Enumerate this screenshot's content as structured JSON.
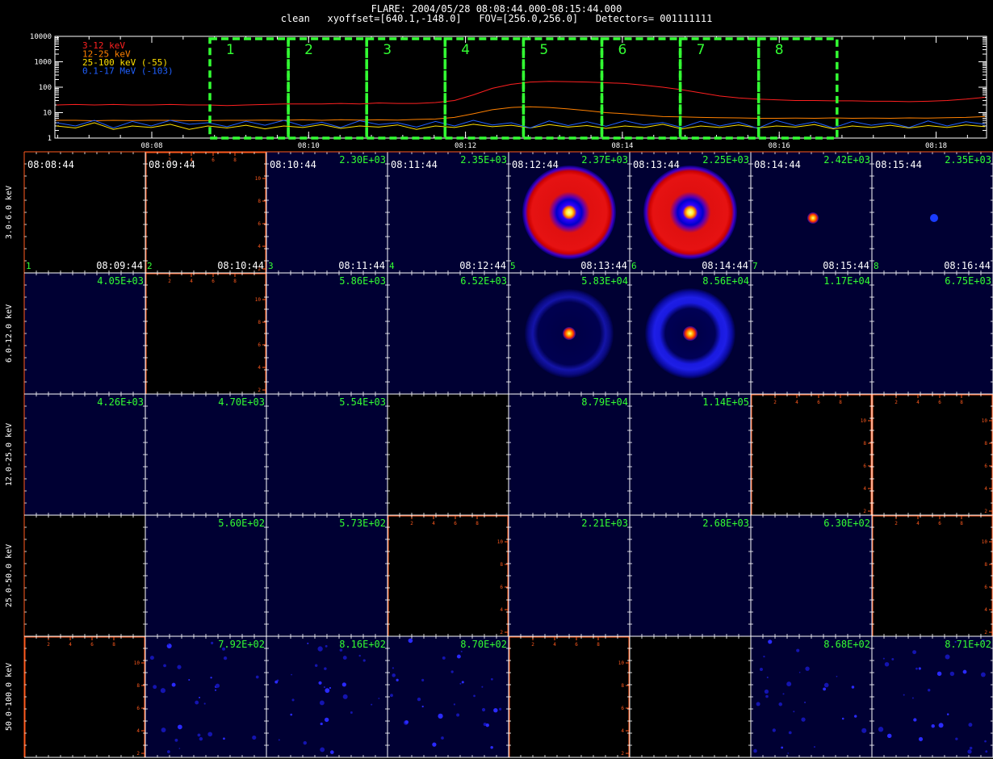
{
  "header": {
    "title": "FLARE: 2004/05/28 08:08:44.000-08:15:44.000",
    "subtitle": "clean   xyoffset=[640.1,-148.0]   FOV=[256.0,256.0]   Detectors= 001111111"
  },
  "chart_data": [
    {
      "type": "line",
      "name": "lightcurve",
      "y_scale": "log",
      "ylim": [
        1,
        10000
      ],
      "y_ticks": [
        "10000",
        "1000",
        "100",
        "10",
        "1"
      ],
      "x_ticks": [
        "08:08",
        "08:10",
        "08:12",
        "08:14",
        "08:16",
        "08:18"
      ],
      "series": [
        {
          "name": "3-12 keV",
          "color": "#ff2020",
          "values": [
            20,
            21,
            20,
            21,
            20,
            20,
            21,
            20,
            20,
            19,
            20,
            21,
            22,
            22,
            22,
            23,
            22,
            24,
            23,
            23,
            25,
            30,
            50,
            90,
            130,
            160,
            170,
            165,
            160,
            150,
            140,
            120,
            100,
            80,
            60,
            45,
            38,
            34,
            32,
            30,
            30,
            29,
            29,
            28,
            28,
            27,
            28,
            30,
            34,
            40
          ]
        },
        {
          "name": "12-25 keV",
          "color": "#ff8000",
          "values": [
            5,
            5,
            4.8,
            5,
            4.9,
            5,
            5,
            4.8,
            4.9,
            5,
            5,
            5.1,
            5,
            5.2,
            5,
            5.3,
            5.1,
            5.2,
            5.1,
            5.4,
            5.6,
            6.5,
            9,
            13,
            16,
            17,
            16,
            14,
            12,
            10,
            9,
            8,
            7,
            6.8,
            6.5,
            6.3,
            6.2,
            6,
            6,
            6.1,
            6,
            6.2,
            6,
            6.1,
            6,
            6.2,
            6.1,
            6.3,
            6.5,
            7
          ]
        },
        {
          "name": "25-100 keV (-55)",
          "color": "#ffe000",
          "values": [
            3,
            2.5,
            4,
            2.2,
            3,
            2.6,
            3.5,
            2.2,
            3,
            2.5,
            3.2,
            2.3,
            3,
            2.6,
            3.4,
            2.4,
            3,
            2.7,
            3.3,
            2.2,
            3,
            2.6,
            3.5,
            2.8,
            3.2,
            2.5,
            3.4,
            2.7,
            3.1,
            2.4,
            3,
            2.6,
            3.5,
            2.3,
            3,
            2.6,
            3.3,
            2.5,
            3,
            2.7,
            3.4,
            2.3,
            3,
            2.6,
            3.2,
            2.5,
            3.1,
            2.6,
            3.3,
            2.8
          ]
        },
        {
          "name": "0.1-17 MeV (-103)",
          "color": "#2060ff",
          "values": [
            4,
            3,
            5,
            2.5,
            4.5,
            3,
            5,
            3.5,
            4,
            2.8,
            4.6,
            3.2,
            5,
            3,
            4.2,
            2.6,
            4.8,
            3.4,
            4,
            2.7,
            4.5,
            3,
            5,
            3.3,
            4,
            2.5,
            4.7,
            3.1,
            4.4,
            2.9,
            4.8,
            3.3,
            4.1,
            2.6,
            4.6,
            3,
            4.2,
            2.4,
            4.9,
            3.1,
            4.3,
            2.5,
            4.5,
            3.2,
            4,
            2.6,
            4.7,
            3,
            4.4,
            3.5
          ]
        }
      ],
      "time_intervals": [
        "1",
        "2",
        "3",
        "4",
        "5",
        "6",
        "7",
        "8"
      ]
    },
    {
      "type": "heatmap",
      "name": "image-grid",
      "rows": [
        "3.0-6.0 keV",
        "6.0-12.0 keV",
        "12.0-25.0 keV",
        "25.0-50.0 keV",
        "50.0-100.0 keV"
      ],
      "columns": [
        "08:08:44",
        "08:09:44",
        "08:10:44",
        "08:11:44",
        "08:12:44",
        "08:13:44",
        "08:14:44",
        "08:15:44"
      ],
      "end_times": [
        "08:09:44",
        "08:10:44",
        "08:11:44",
        "08:12:44",
        "08:13:44",
        "08:14:44",
        "08:15:44",
        "08:16:44"
      ],
      "interval_numbers": [
        "1",
        "2",
        "3",
        "4",
        "5",
        "6",
        "7",
        "8"
      ],
      "axis_ticks_y": [
        "2",
        "4",
        "6",
        "8",
        "10"
      ],
      "axis_ticks_x": [
        "2",
        "4",
        "6",
        "8"
      ],
      "cells": [
        [
          {
            "label": "",
            "image": "blank"
          },
          {
            "label": "",
            "image": "axes"
          },
          {
            "label": "2.30E+03",
            "image": "none"
          },
          {
            "label": "2.35E+03",
            "image": "none"
          },
          {
            "label": "2.37E+03",
            "image": "ring-big"
          },
          {
            "label": "2.25E+03",
            "image": "ring-big"
          },
          {
            "label": "2.42E+03",
            "image": "spot-small"
          },
          {
            "label": "2.35E+03",
            "image": "spot-tiny"
          }
        ],
        [
          {
            "label": "4.05E+03",
            "image": "none"
          },
          {
            "label": "",
            "image": "axes"
          },
          {
            "label": "5.86E+03",
            "image": "none"
          },
          {
            "label": "6.52E+03",
            "image": "none"
          },
          {
            "label": "5.83E+04",
            "image": "ring-faint"
          },
          {
            "label": "8.56E+04",
            "image": "ring-blue"
          },
          {
            "label": "1.17E+04",
            "image": "none"
          },
          {
            "label": "6.75E+03",
            "image": "none"
          }
        ],
        [
          {
            "label": "4.26E+03",
            "image": "none"
          },
          {
            "label": "4.70E+03",
            "image": "none"
          },
          {
            "label": "5.54E+03",
            "image": "none"
          },
          {
            "label": "",
            "image": "blank"
          },
          {
            "label": "8.79E+04",
            "image": "none"
          },
          {
            "label": "1.14E+05",
            "image": "none"
          },
          {
            "label": "",
            "image": "axes"
          },
          {
            "label": "",
            "image": "axes"
          }
        ],
        [
          {
            "label": "",
            "image": "blank"
          },
          {
            "label": "5.60E+02",
            "image": "none"
          },
          {
            "label": "5.73E+02",
            "image": "none"
          },
          {
            "label": "",
            "image": "axes"
          },
          {
            "label": "2.21E+03",
            "image": "none"
          },
          {
            "label": "2.68E+03",
            "image": "none"
          },
          {
            "label": "6.30E+02",
            "image": "none"
          },
          {
            "label": "",
            "image": "axes"
          }
        ],
        [
          {
            "label": "",
            "image": "axes"
          },
          {
            "label": "7.92E+02",
            "image": "noise"
          },
          {
            "label": "8.16E+02",
            "image": "noise"
          },
          {
            "label": "8.70E+02",
            "image": "noise"
          },
          {
            "label": "",
            "image": "axes"
          },
          {
            "label": "",
            "image": "blank"
          },
          {
            "label": "8.68E+02",
            "image": "noise"
          },
          {
            "label": "8.71E+02",
            "image": "noise"
          }
        ]
      ]
    }
  ],
  "colors": {
    "background": "#000000",
    "panel_blue": "#000033",
    "grid_white": "#ffffff",
    "axis_orange": "#ff5a1e",
    "label_green": "#33ff33",
    "interval_box_green": "#33ff33"
  }
}
